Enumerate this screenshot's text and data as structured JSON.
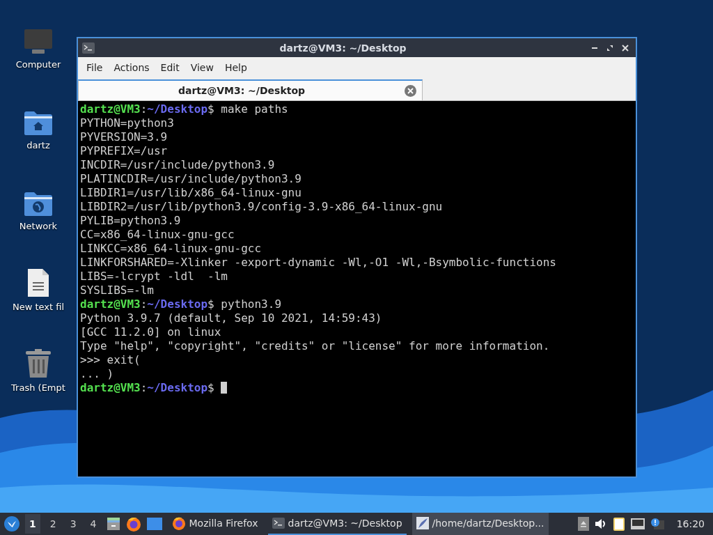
{
  "desktop_icons": [
    {
      "kind": "computer",
      "label": "Computer"
    },
    {
      "kind": "home",
      "label": "dartz"
    },
    {
      "kind": "network",
      "label": "Network"
    },
    {
      "kind": "textfile",
      "label": "New text fil"
    },
    {
      "kind": "trash",
      "label": "Trash (Empt"
    }
  ],
  "window": {
    "title": "dartz@VM3: ~/Desktop",
    "menu": [
      "File",
      "Actions",
      "Edit",
      "View",
      "Help"
    ],
    "tabs": [
      {
        "label": "dartz@VM3: ~/Desktop",
        "selected": true
      }
    ],
    "terminal": [
      {
        "kind": "prompt",
        "user": "dartz@VM3",
        "sep": ":",
        "path": "~/Desktop",
        "command": "$ make paths"
      },
      {
        "kind": "output",
        "text": "PYTHON=python3"
      },
      {
        "kind": "output",
        "text": "PYVERSION=3.9"
      },
      {
        "kind": "output",
        "text": "PYPREFIX=/usr"
      },
      {
        "kind": "output",
        "text": "INCDIR=/usr/include/python3.9"
      },
      {
        "kind": "output",
        "text": "PLATINCDIR=/usr/include/python3.9"
      },
      {
        "kind": "output",
        "text": "LIBDIR1=/usr/lib/x86_64-linux-gnu"
      },
      {
        "kind": "output",
        "text": "LIBDIR2=/usr/lib/python3.9/config-3.9-x86_64-linux-gnu"
      },
      {
        "kind": "output",
        "text": "PYLIB=python3.9"
      },
      {
        "kind": "output",
        "text": "CC=x86_64-linux-gnu-gcc"
      },
      {
        "kind": "output",
        "text": "LINKCC=x86_64-linux-gnu-gcc"
      },
      {
        "kind": "output",
        "text": "LINKFORSHARED=-Xlinker -export-dynamic -Wl,-O1 -Wl,-Bsymbolic-functions"
      },
      {
        "kind": "output",
        "text": "LIBS=-lcrypt -ldl  -lm"
      },
      {
        "kind": "output",
        "text": "SYSLIBS=-lm"
      },
      {
        "kind": "prompt",
        "user": "dartz@VM3",
        "sep": ":",
        "path": "~/Desktop",
        "command": "$ python3.9"
      },
      {
        "kind": "output",
        "text": "Python 3.9.7 (default, Sep 10 2021, 14:59:43)"
      },
      {
        "kind": "output",
        "text": "[GCC 11.2.0] on linux"
      },
      {
        "kind": "output",
        "text": "Type \"help\", \"copyright\", \"credits\" or \"license\" for more information."
      },
      {
        "kind": "output",
        "text": ">>> exit("
      },
      {
        "kind": "output",
        "text": "... )"
      },
      {
        "kind": "prompt",
        "user": "dartz@VM3",
        "sep": ":",
        "path": "~/Desktop",
        "command": "$ ",
        "cursor": true
      }
    ]
  },
  "taskbar": {
    "workspaces": [
      {
        "label": "1",
        "selected": true
      },
      {
        "label": "2",
        "selected": false
      },
      {
        "label": "3",
        "selected": false
      },
      {
        "label": "4",
        "selected": false
      }
    ],
    "launchers": [
      {
        "kind": "files"
      },
      {
        "kind": "firefox"
      },
      {
        "kind": "desktop"
      }
    ],
    "tasks": [
      {
        "kind": "firefox",
        "label": "Mozilla Firefox",
        "selected": false,
        "hovered": false
      },
      {
        "kind": "terminal",
        "label": "dartz@VM3: ~/Desktop",
        "selected": true,
        "hovered": false
      },
      {
        "kind": "editor",
        "label": "/home/dartz/Desktop...",
        "selected": false,
        "hovered": true
      }
    ],
    "clock": "16:20"
  }
}
